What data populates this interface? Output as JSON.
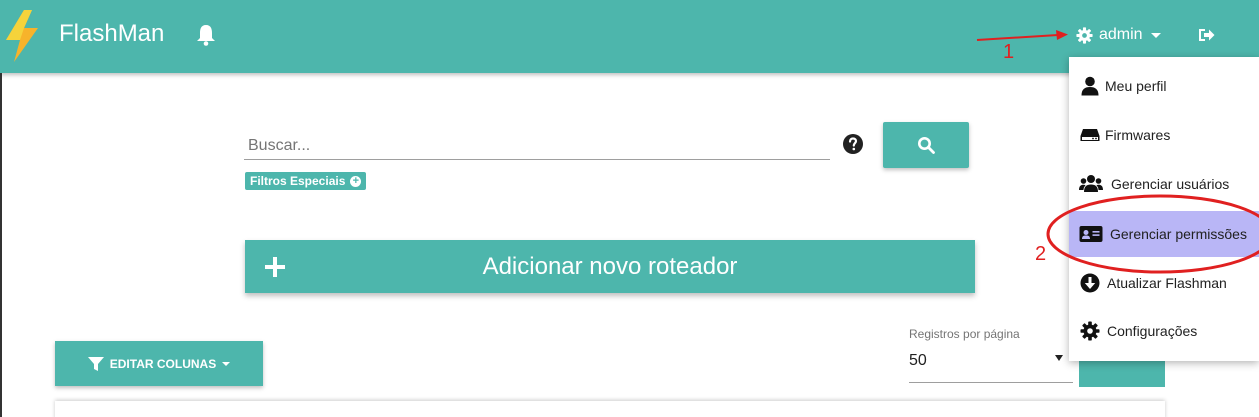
{
  "navbar": {
    "brand": "FlashMan",
    "user_label": "admin",
    "icons": {
      "logo": "lightning-bolt-icon",
      "notifications": "bell-icon",
      "settings": "gear-icon",
      "logout": "logout-icon"
    },
    "color": "#4db6ac"
  },
  "search": {
    "placeholder": "Buscar...",
    "value": "",
    "filters_label": "Filtros Especiais",
    "help_icon": "question-circle-icon",
    "button_icon": "search-icon"
  },
  "main": {
    "add_router_label": "Adicionar novo roteador",
    "edit_columns_label": "EDITAR COLUNAS",
    "per_page_label": "Registros por página",
    "per_page_value": "50"
  },
  "user_menu": {
    "items": [
      {
        "label": "Meu perfil",
        "icon": "user-icon"
      },
      {
        "label": "Firmwares",
        "icon": "hard-drive-icon"
      },
      {
        "label": "Gerenciar usuários",
        "icon": "users-icon"
      },
      {
        "label": "Gerenciar permissões",
        "icon": "id-card-icon",
        "highlighted": true
      },
      {
        "label": "Atualizar Flashman",
        "icon": "arrow-circle-down-icon"
      },
      {
        "label": "Configurações",
        "icon": "gear-icon"
      }
    ],
    "highlight_color": "#b9b6f6"
  },
  "annotations": {
    "step1": "1",
    "step2": "2",
    "color": "#e02020"
  }
}
